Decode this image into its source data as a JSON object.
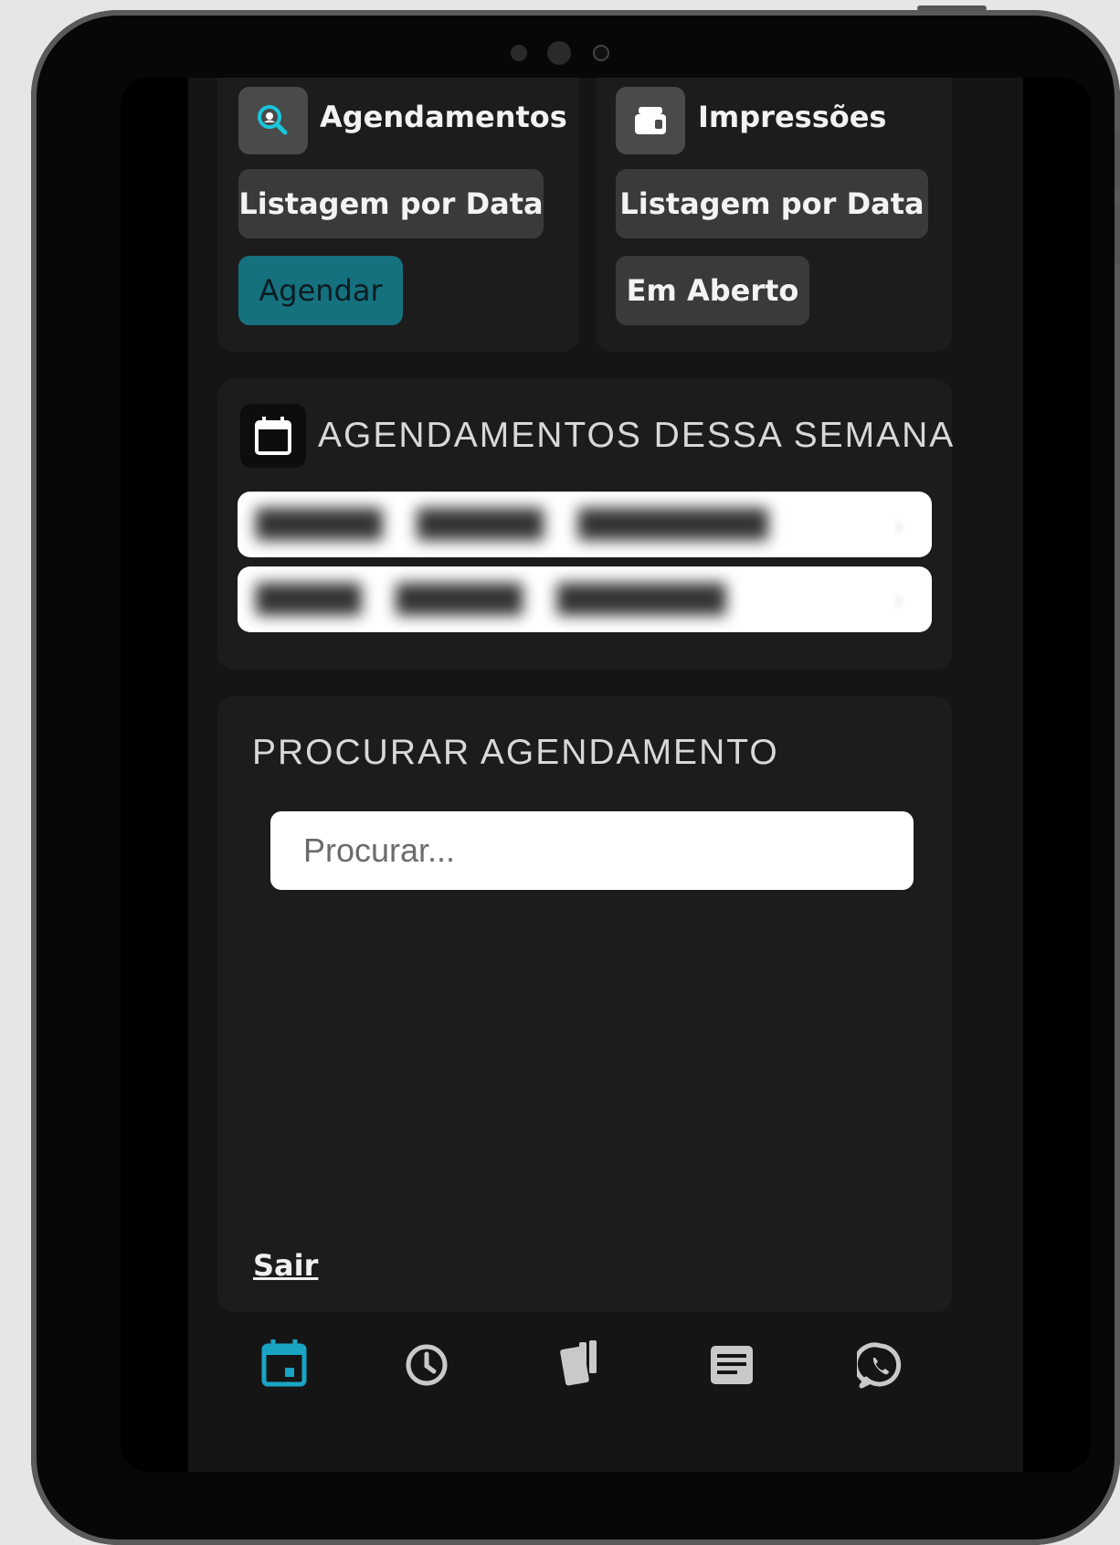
{
  "cards": [
    {
      "title": "Agendamentos",
      "icon": "search-calendar-icon",
      "buttons": [
        "Listagem por Data",
        "Agendar"
      ]
    },
    {
      "title": "Impressões",
      "icon": "wallet-icon",
      "buttons": [
        "Listagem por Data",
        "Em Aberto"
      ]
    }
  ],
  "week": {
    "title": "AGENDAMENTOS DESSA SEMANA",
    "icon": "calendar-icon",
    "rows": [
      {
        "blurred": true
      },
      {
        "blurred": true
      }
    ]
  },
  "search": {
    "title": "PROCURAR AGENDAMENTO",
    "placeholder": "Procurar..."
  },
  "logout_label": "Sair",
  "tabbar": [
    {
      "icon": "calendar-icon",
      "active": true
    },
    {
      "icon": "clock-icon"
    },
    {
      "icon": "cards-icon"
    },
    {
      "icon": "document-icon"
    },
    {
      "icon": "whatsapp-icon"
    }
  ],
  "colors": {
    "accent": "#1aa4c4",
    "accent_button": "#16717f",
    "background": "#151515",
    "card": "#1c1c1c"
  }
}
